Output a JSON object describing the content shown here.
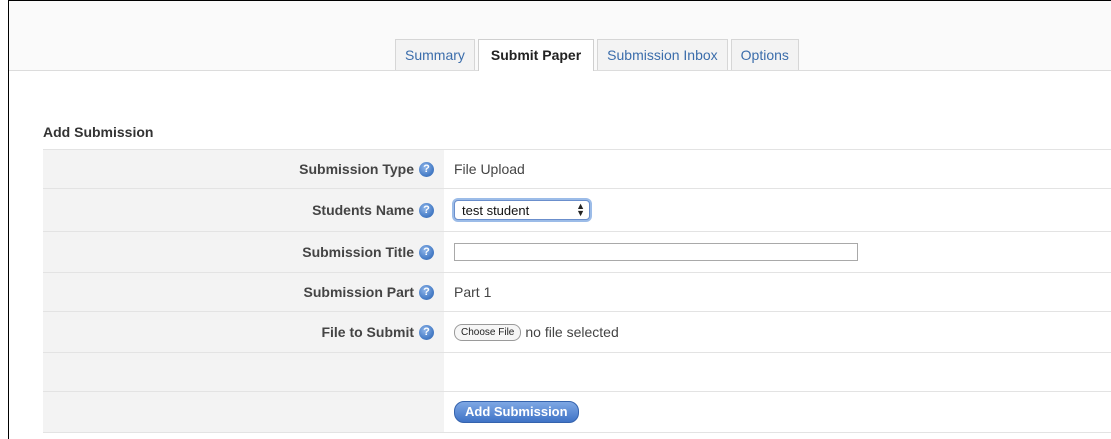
{
  "tabs": [
    {
      "label": "Summary",
      "active": false
    },
    {
      "label": "Submit Paper",
      "active": true
    },
    {
      "label": "Submission Inbox",
      "active": false
    },
    {
      "label": "Options",
      "active": false
    }
  ],
  "section": {
    "title": "Add Submission"
  },
  "form": {
    "submission_type": {
      "label": "Submission Type",
      "value": "File Upload"
    },
    "students_name": {
      "label": "Students Name",
      "selected": "test student"
    },
    "submission_title": {
      "label": "Submission Title",
      "value": "",
      "placeholder": ""
    },
    "submission_part": {
      "label": "Submission Part",
      "value": "Part 1"
    },
    "file_to_submit": {
      "label": "File to Submit",
      "button_label": "Choose File",
      "status": "no file selected"
    },
    "submit_label": "Add Submission"
  },
  "icons": {
    "help": "question-mark-help-icon",
    "select_arrows": "up-down-arrows-icon"
  },
  "colors": {
    "accent": "#3f73c6",
    "tab_link": "#3b6dab",
    "label_bg": "#f3f3f3"
  }
}
